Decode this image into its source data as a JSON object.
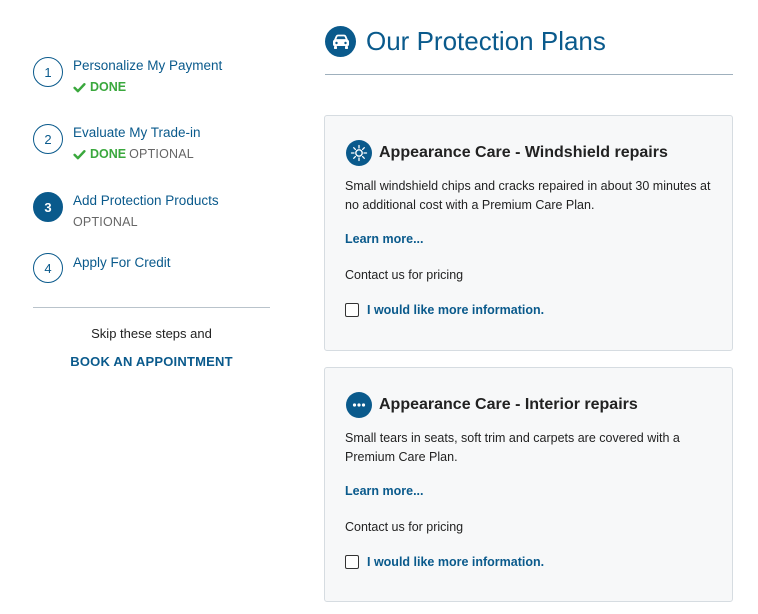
{
  "steps": [
    {
      "number": "1",
      "title": "Personalize My Payment",
      "status_done": "DONE",
      "status_optional": ""
    },
    {
      "number": "2",
      "title": "Evaluate My Trade-in",
      "status_done": "DONE",
      "status_optional": "OPTIONAL"
    },
    {
      "number": "3",
      "title": "Add Protection Products",
      "status_done": "",
      "status_optional": "OPTIONAL"
    },
    {
      "number": "4",
      "title": "Apply For Credit",
      "status_done": "",
      "status_optional": ""
    }
  ],
  "sidebar": {
    "skip_text": "Skip these steps and",
    "book_label": "BOOK AN APPOINTMENT"
  },
  "header": {
    "title": "Our Protection Plans",
    "icon": "car-icon"
  },
  "plans": [
    {
      "icon": "sun-burst-icon",
      "title": "Appearance Care - Windshield repairs",
      "description": "Small windshield chips and cracks repaired in about 30 minutes at no additional cost with a Premium Care Plan.",
      "learn_more": "Learn more...",
      "pricing": "Contact us for pricing",
      "info_label": "I would like more information.",
      "checked": false
    },
    {
      "icon": "ellipsis-icon",
      "title": "Appearance Care - Interior repairs",
      "description": "Small tears in seats, soft trim and carpets are covered with a Premium Care Plan.",
      "learn_more": "Learn more...",
      "pricing": "Contact us for pricing",
      "info_label": "I would like more information.",
      "checked": false
    }
  ],
  "colors": {
    "brand": "#0a5a8c",
    "done": "#3aa83d",
    "card_bg": "#f7f8f9"
  }
}
